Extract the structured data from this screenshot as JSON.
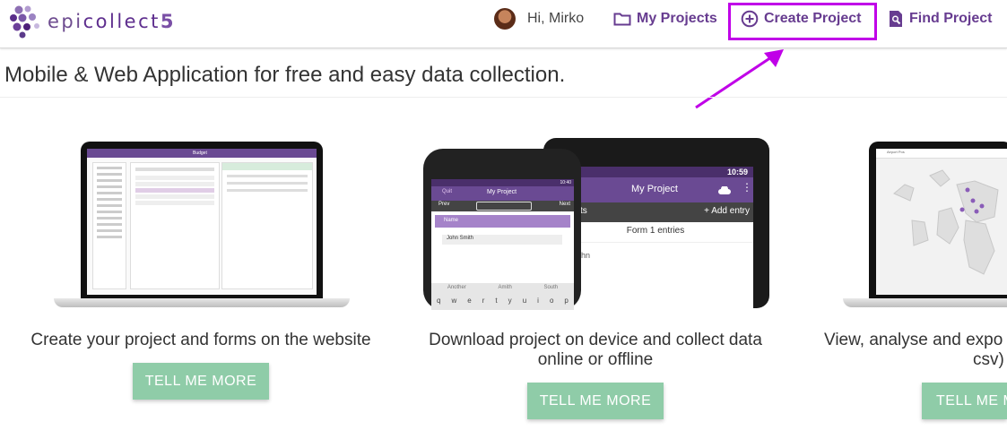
{
  "brand": {
    "prefix": "epi",
    "middle": "collect",
    "suffix": "5",
    "colors": {
      "primary": "#673c90",
      "highlight": "#c000e8",
      "button": "#8fcca8"
    }
  },
  "nav": {
    "greeting": "Hi, Mirko",
    "my_projects": "My Projects",
    "create_project": "Create Project",
    "find_project": "Find Project"
  },
  "tagline": "Mobile & Web Application for free and easy data collection.",
  "cards": [
    {
      "text": "Create your project and forms on the website",
      "button": "TELL ME MORE"
    },
    {
      "text_line1": "Download project on device and collect data",
      "text_line2": "online or offline",
      "button": "TELL ME MORE"
    },
    {
      "text_line1": "View, analyse and expo",
      "text_line2": "csv)",
      "button": "TELL ME M"
    }
  ],
  "screens": {
    "laptop1_title": "Budget",
    "tablet_statusbar_time": "10:59",
    "tablet_title": "My Project",
    "tablet_toolbar_left": "cts",
    "tablet_add_entry": "+ Add entry",
    "tablet_form_entries": "Form 1 entries",
    "tablet_row": "hn",
    "phone_statusbar_time": "10:40",
    "phone_quit": "Quit",
    "phone_title": "My Project",
    "phone_prev": "Prev",
    "phone_next": "Next",
    "phone_field_label": "Name",
    "phone_field_value": "John Smith",
    "phone_suggestions": [
      "Another",
      "Amith",
      "South"
    ],
    "phone_keys": [
      "q",
      "w",
      "e",
      "r",
      "t",
      "y",
      "u",
      "i",
      "o",
      "p"
    ],
    "laptop3_title": "Airport Pos"
  }
}
